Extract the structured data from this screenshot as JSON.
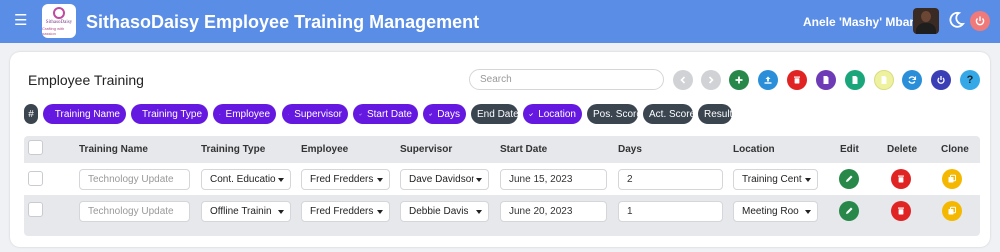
{
  "header": {
    "app_title": "SithasoDaisy Employee Training Management",
    "logo_text_1": "SithasoDaisy",
    "logo_text_2": "Crafting with passion",
    "user_name": "Anele 'Mashy' Mbanga",
    "icons": [
      "menu-icon",
      "avatar",
      "moon-icon",
      "power-icon"
    ],
    "colors": {
      "bar": "#5a8de6",
      "power": "#f07a7a"
    }
  },
  "card": {
    "title": "Employee Training",
    "search_placeholder": "Search"
  },
  "toolbar": {
    "buttons": [
      {
        "name": "prev-button",
        "icon": "chevron-left-icon",
        "color": "#c8cacd"
      },
      {
        "name": "next-button",
        "icon": "chevron-right-icon",
        "color": "#c8cacd"
      },
      {
        "name": "add-button",
        "icon": "plus-icon",
        "color": "#28884a"
      },
      {
        "name": "upload-button",
        "icon": "upload-icon",
        "color": "#2a8fd8"
      },
      {
        "name": "delete-all-button",
        "icon": "trash-icon",
        "color": "#e02424"
      },
      {
        "name": "pdf-button",
        "icon": "file-icon",
        "color": "#6d3bb5"
      },
      {
        "name": "excel-button",
        "icon": "file-icon",
        "color": "#1aa67a"
      },
      {
        "name": "csv-button",
        "icon": "file-icon",
        "color": "#e8f09a"
      },
      {
        "name": "refresh-button",
        "icon": "refresh-icon",
        "color": "#2a8fd8"
      },
      {
        "name": "power-button",
        "icon": "power-icon",
        "color": "#3a3fb5"
      },
      {
        "name": "help-button",
        "icon": "question-icon",
        "color": "#35a9e8"
      }
    ]
  },
  "chips": {
    "hash": "#",
    "items": [
      {
        "label": "Training Name",
        "checked": true
      },
      {
        "label": "Training Type",
        "checked": true
      },
      {
        "label": "Employee",
        "checked": true
      },
      {
        "label": "Supervisor",
        "checked": true
      },
      {
        "label": "Start Date",
        "checked": true
      },
      {
        "label": "Days",
        "checked": true
      },
      {
        "label": "End Date",
        "checked": false
      },
      {
        "label": "Location",
        "checked": true
      },
      {
        "label": "Pos. Score",
        "checked": false
      },
      {
        "label": "Act. Score",
        "checked": false
      },
      {
        "label": "Result",
        "checked": false
      }
    ],
    "colors": {
      "on": "#6418e0",
      "off": "#3a4550"
    }
  },
  "table": {
    "headers": [
      "Training Name",
      "Training Type",
      "Employee",
      "Supervisor",
      "Start Date",
      "Days",
      "Location",
      "Edit",
      "Delete",
      "Clone"
    ],
    "rows": [
      {
        "training_name_placeholder": "Technology Update",
        "training_type": "Cont. Educatio",
        "employee": "Fred Fredders",
        "supervisor": "Dave Davidson",
        "start_date": "June 15, 2023",
        "days": "2",
        "location": "Training Cent"
      },
      {
        "training_name_placeholder": "Technology Update",
        "training_type": "Offline Trainin",
        "employee": "Fred Fredders",
        "supervisor": "Debbie Davis",
        "start_date": "June 20, 2023",
        "days": "1",
        "location": "Meeting Roo"
      }
    ],
    "row_action_icons": [
      "pencil-icon",
      "trash-icon",
      "copy-icon"
    ]
  }
}
